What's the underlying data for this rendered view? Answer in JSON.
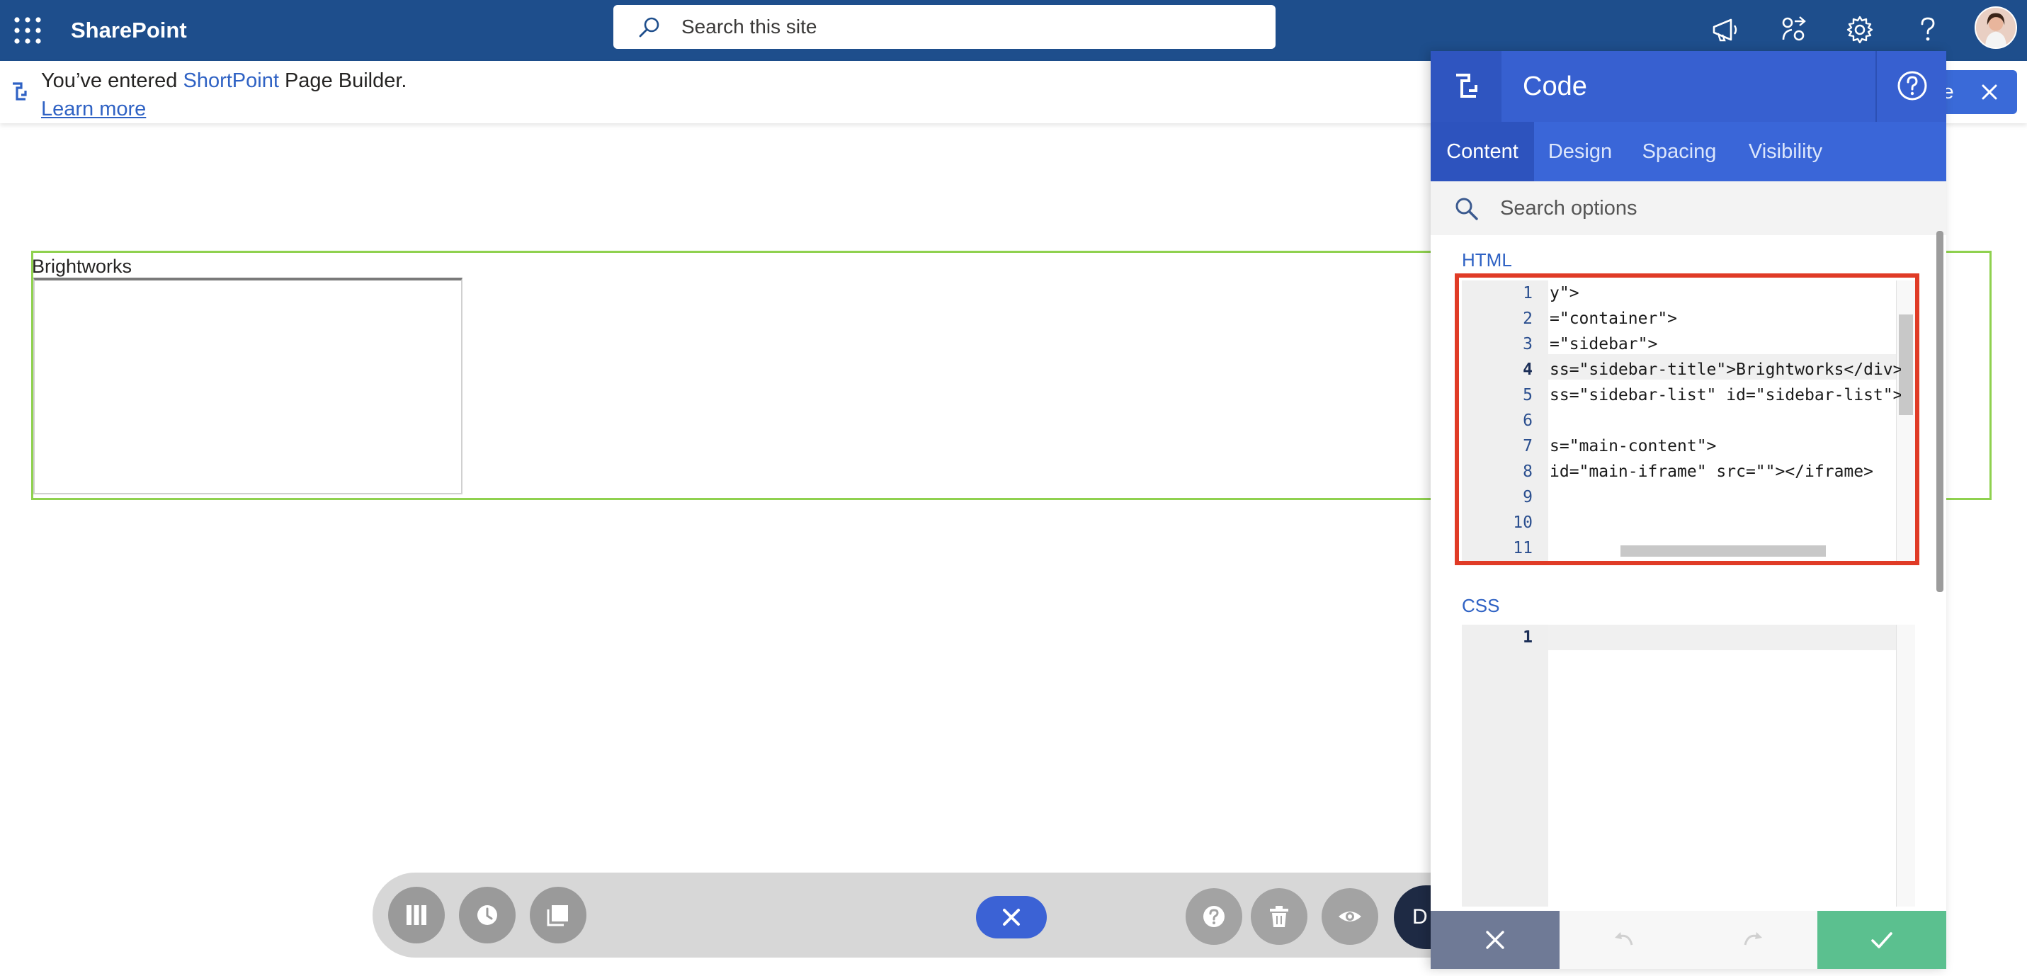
{
  "suitebar": {
    "app_name": "SharePoint",
    "search_placeholder": "Search this site",
    "icons": [
      "waffle-icon",
      "megaphone-icon",
      "share-icon",
      "gear-icon",
      "help-icon"
    ]
  },
  "notice": {
    "prefix": "You’ve entered ",
    "brand": "ShortPoint",
    "suffix": " Page Builder.",
    "learn_more": "Learn more",
    "close_label": "se"
  },
  "canvas": {
    "frame_title": "Brightworks"
  },
  "toolbar": {
    "dark_button_label": "D",
    "icons": [
      "columns-icon",
      "history-icon",
      "layers-icon",
      "close-icon",
      "help-icon",
      "trash-icon",
      "eye-icon"
    ]
  },
  "panel": {
    "title": "Code",
    "tabs": [
      {
        "label": "Content",
        "active": true
      },
      {
        "label": "Design",
        "active": false
      },
      {
        "label": "Spacing",
        "active": false
      },
      {
        "label": "Visibility",
        "active": false
      }
    ],
    "search_placeholder": "Search options",
    "html_label": "HTML",
    "css_label": "CSS",
    "html_lines": [
      {
        "n": "1",
        "code": "y\">"
      },
      {
        "n": "2",
        "code": "=\"container\">"
      },
      {
        "n": "3",
        "code": "=\"sidebar\">"
      },
      {
        "n": "4",
        "code": "ss=\"sidebar-title\">Brightworks</div>"
      },
      {
        "n": "5",
        "code": "ss=\"sidebar-list\" id=\"sidebar-list\">"
      },
      {
        "n": "6",
        "code": ""
      },
      {
        "n": "7",
        "code": "s=\"main-content\">"
      },
      {
        "n": "8",
        "code": "id=\"main-iframe\" src=\"\"></iframe>"
      },
      {
        "n": "9",
        "code": ""
      },
      {
        "n": "10",
        "code": ""
      },
      {
        "n": "11",
        "code": ""
      }
    ],
    "html_current_line": 4,
    "css_lines": [
      {
        "n": "1",
        "code": ""
      }
    ],
    "accent_color": "#3760d0",
    "confirm_color": "#5bc08f",
    "highlight_outline_color": "#e03b26"
  }
}
